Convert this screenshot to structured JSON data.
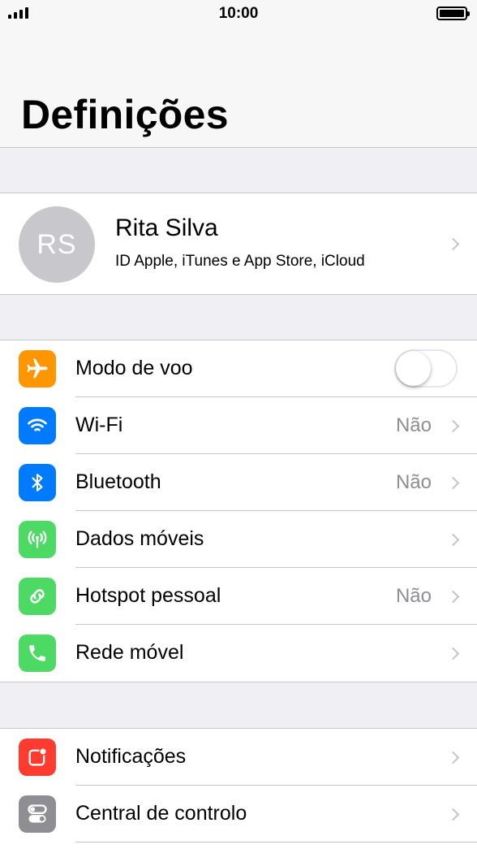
{
  "status_bar": {
    "time": "10:00"
  },
  "nav": {
    "title": "Definições"
  },
  "profile": {
    "initials": "RS",
    "name": "Rita Silva",
    "subtitle": "ID Apple, iTunes e App Store, iCloud"
  },
  "connectivity": [
    {
      "label": "Modo de voo",
      "value": "",
      "icon": "airplane-icon",
      "color": "#ff9500",
      "toggle_on": false
    },
    {
      "label": "Wi-Fi",
      "value": "Não",
      "icon": "wifi-icon",
      "color": "#007aff"
    },
    {
      "label": "Bluetooth",
      "value": "Não",
      "icon": "bluetooth-icon",
      "color": "#007aff"
    },
    {
      "label": "Dados móveis",
      "value": "",
      "icon": "cellular-antenna-icon",
      "color": "#4cd964"
    },
    {
      "label": "Hotspot pessoal",
      "value": "Não",
      "icon": "hotspot-link-icon",
      "color": "#4cd964"
    },
    {
      "label": "Rede móvel",
      "value": "",
      "icon": "phone-icon",
      "color": "#4cd964"
    }
  ],
  "system": [
    {
      "label": "Notificações",
      "icon": "notifications-icon",
      "color": "#ff3b30"
    },
    {
      "label": "Central de controlo",
      "icon": "control-center-icon",
      "color": "#8e8e93"
    }
  ]
}
